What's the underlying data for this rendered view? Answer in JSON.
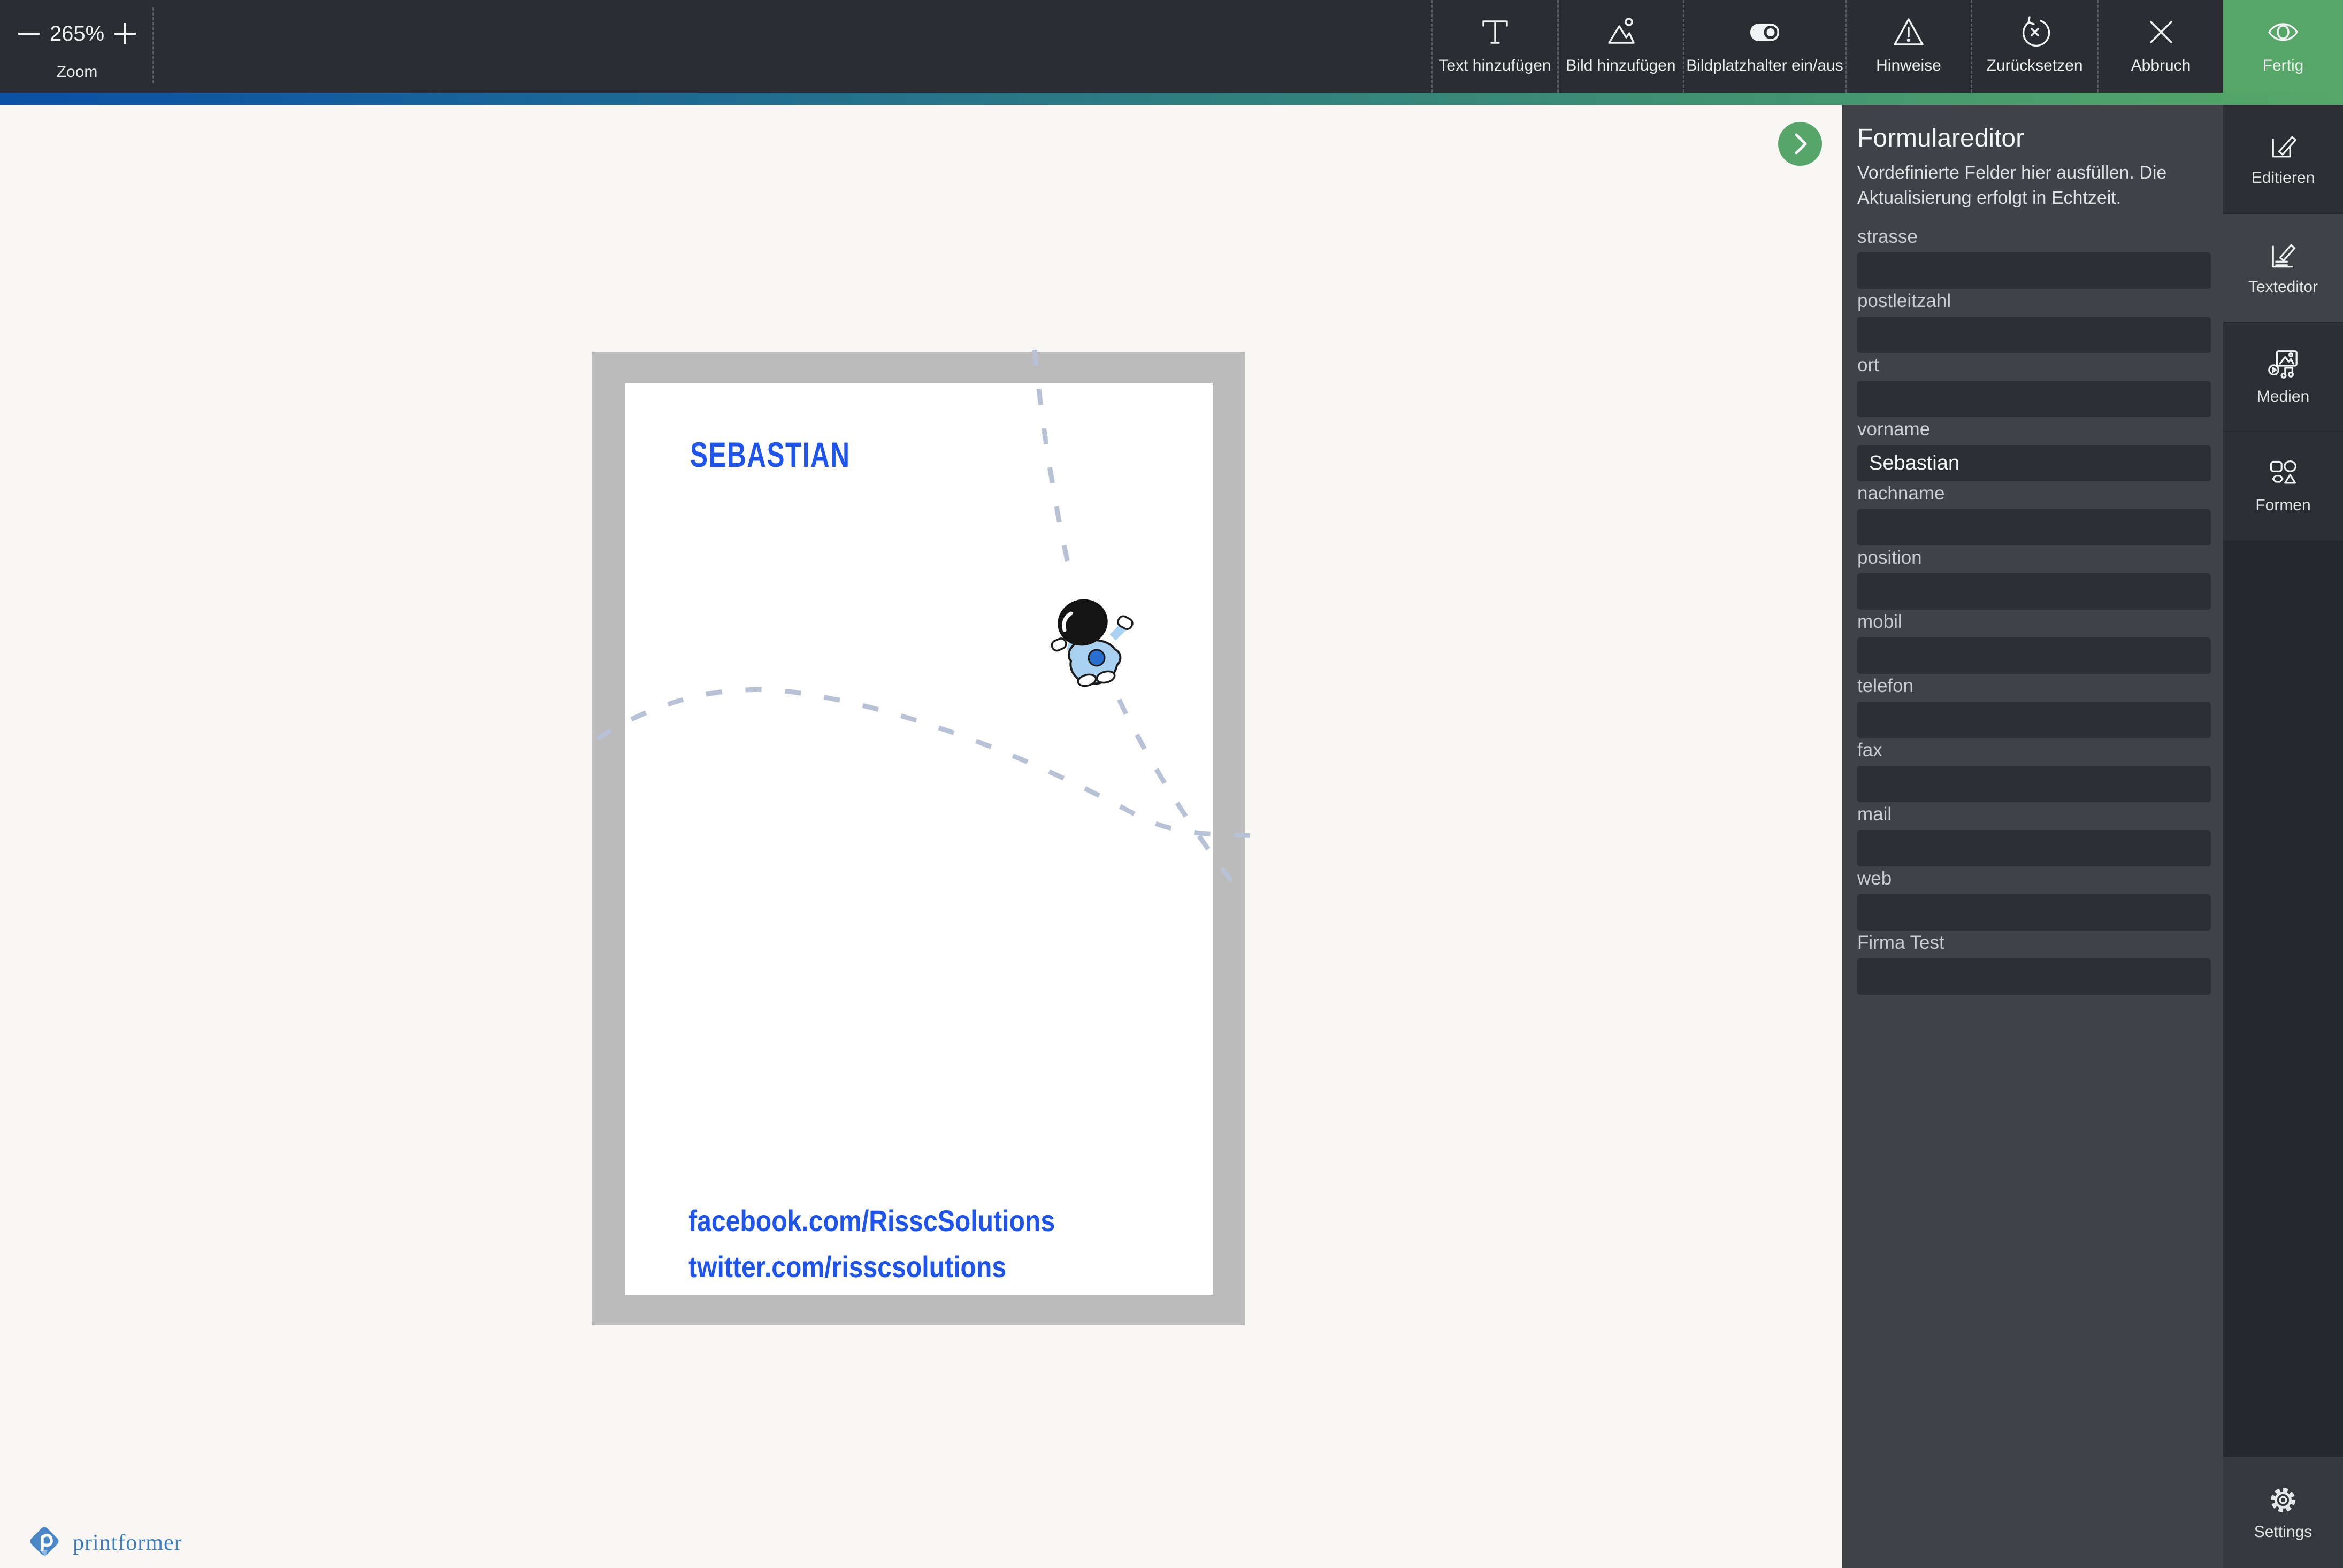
{
  "toolbar": {
    "zoom": {
      "value": "265%",
      "label": "Zoom"
    },
    "buttons": [
      {
        "label": "Text hinzufügen"
      },
      {
        "label": "Bild hinzufügen"
      },
      {
        "label": "Bildplatzhalter ein/aus"
      },
      {
        "label": "Hinweise"
      },
      {
        "label": "Zurücksetzen"
      },
      {
        "label": "Abbruch"
      }
    ],
    "finish_label": "Fertig"
  },
  "panel": {
    "title": "Formulareditor",
    "subtitle": "Vordefinierte Felder hier ausfüllen. Die Aktualisierung erfolgt in Echtzeit.",
    "fields": [
      {
        "label": "strasse",
        "value": ""
      },
      {
        "label": "postleitzahl",
        "value": ""
      },
      {
        "label": "ort",
        "value": ""
      },
      {
        "label": "vorname",
        "value": "Sebastian"
      },
      {
        "label": "nachname",
        "value": ""
      },
      {
        "label": "position",
        "value": ""
      },
      {
        "label": "mobil",
        "value": ""
      },
      {
        "label": "telefon",
        "value": ""
      },
      {
        "label": "fax",
        "value": ""
      },
      {
        "label": "mail",
        "value": ""
      },
      {
        "label": "web",
        "value": ""
      },
      {
        "label": "Firma Test",
        "value": ""
      }
    ]
  },
  "rail": {
    "tabs": [
      {
        "label": "Editieren",
        "active": false
      },
      {
        "label": "Texteditor",
        "active": true
      },
      {
        "label": "Medien",
        "active": false
      },
      {
        "label": "Formen",
        "active": false
      }
    ],
    "settings_label": "Settings"
  },
  "canvas": {
    "card": {
      "name": "SEBASTIAN",
      "links": [
        "facebook.com/RisscSolutions",
        "twitter.com/risscsolutions"
      ]
    }
  },
  "footer": {
    "brand": "printformer"
  },
  "colors": {
    "toolbar_bg": "#2b2d33",
    "finish_green": "#57a768",
    "gradient_left": "#0a50a5",
    "gradient_right": "#57a769",
    "panel_bg": "#3f4247",
    "input_bg": "#2b2e33",
    "card_text_blue": "#1d53ee",
    "trail_color": "#b7c2d7",
    "mat_gray": "#bbbbbb"
  }
}
